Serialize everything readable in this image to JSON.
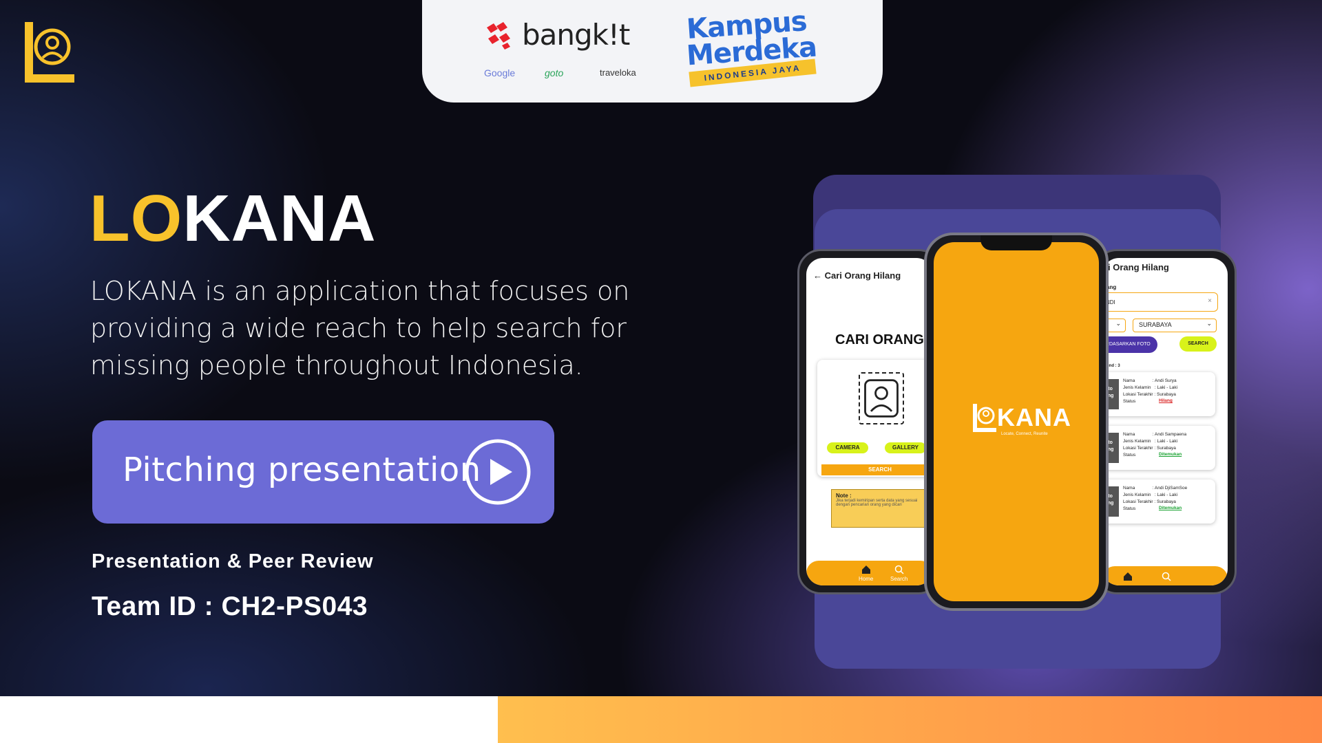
{
  "brand": {
    "title_highlight": "LO",
    "title_rest": "KANA",
    "description": "LOKANA is an application that focuses on providing a wide reach to help search for missing people throughout Indonesia.",
    "accent_color": "#f8c22b",
    "button_color": "#6c6bd6"
  },
  "partners": {
    "bangkit": "bangk!t",
    "sponsors": [
      "Google",
      "goto",
      "traveloka"
    ],
    "kampus_line1": "Kampus",
    "kampus_line2": "Merdeka",
    "kampus_ribbon": "INDONESIA JAYA"
  },
  "cta": {
    "label": "Pitching presentation",
    "icon": "play-icon"
  },
  "subtitle": "Presentation & Peer Review",
  "team_id": "Team ID : CH2-PS043",
  "mockup": {
    "left": {
      "header": "Cari Orang Hilang",
      "title": "CARI ORANG",
      "camera": "CAMERA",
      "gallery": "GALLERY",
      "search": "SEARCH",
      "note_title": "Note :",
      "note_body": "Jika terjadi kemiripan serta data yang sesuai dengan pencarian orang yang dicari",
      "tab_home": "Home",
      "tab_search": "Search"
    },
    "center": {
      "word": "KANA",
      "tagline": "Locate, Connect, Reunite"
    },
    "right": {
      "header": "i Orang Hilang",
      "label": "ang",
      "input_value": "NDI",
      "city": "SURABAYA",
      "foto_btn": "ERDASARKAN FOTO",
      "search_btn": "SEARCH",
      "found": "und : 3",
      "thumb_text": "oto\nang",
      "results": [
        {
          "text": "Nama              : Andi Surya\nJenis Kelamin   : Laki - Laki\nLokasi Terakhir : Surabaya\nStatus",
          "status": "Hilang",
          "status_kind": "red"
        },
        {
          "text": "Nama              : Andi Sampaena\nJenis Kelamin   : Laki - Laki\nLokasi Terakhir : Surabaya\nStatus",
          "status": "Ditemukan",
          "status_kind": "green"
        },
        {
          "text": "Nama              : Andi DjiSamSoe\nJenis Kelamin   : Laki - Laki\nLokasi Terakhir : Surabaya\nStatus",
          "status": "Ditemukan",
          "status_kind": "green"
        }
      ]
    }
  }
}
